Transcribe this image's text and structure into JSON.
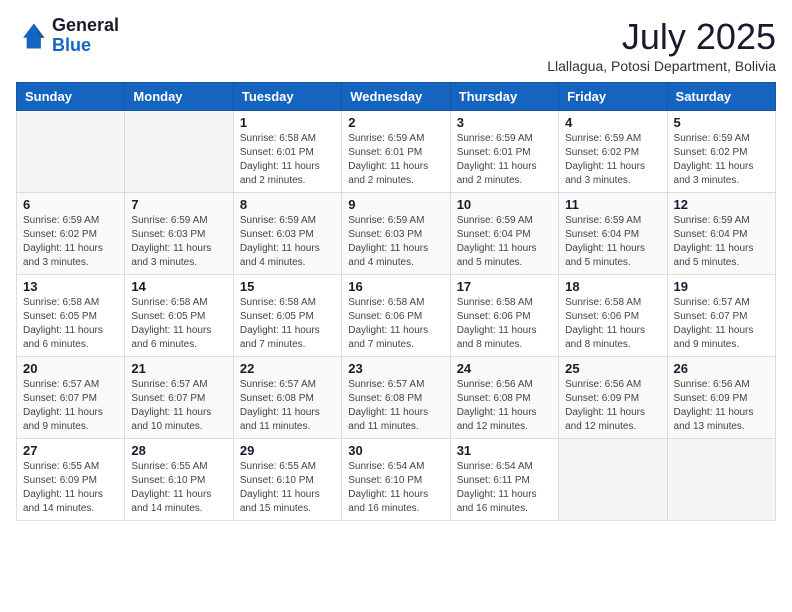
{
  "logo": {
    "general": "General",
    "blue": "Blue"
  },
  "header": {
    "month": "July 2025",
    "subtitle": "Llallagua, Potosi Department, Bolivia"
  },
  "weekdays": [
    "Sunday",
    "Monday",
    "Tuesday",
    "Wednesday",
    "Thursday",
    "Friday",
    "Saturday"
  ],
  "weeks": [
    [
      {
        "day": "",
        "info": ""
      },
      {
        "day": "",
        "info": ""
      },
      {
        "day": "1",
        "info": "Sunrise: 6:58 AM\nSunset: 6:01 PM\nDaylight: 11 hours and 2 minutes."
      },
      {
        "day": "2",
        "info": "Sunrise: 6:59 AM\nSunset: 6:01 PM\nDaylight: 11 hours and 2 minutes."
      },
      {
        "day": "3",
        "info": "Sunrise: 6:59 AM\nSunset: 6:01 PM\nDaylight: 11 hours and 2 minutes."
      },
      {
        "day": "4",
        "info": "Sunrise: 6:59 AM\nSunset: 6:02 PM\nDaylight: 11 hours and 3 minutes."
      },
      {
        "day": "5",
        "info": "Sunrise: 6:59 AM\nSunset: 6:02 PM\nDaylight: 11 hours and 3 minutes."
      }
    ],
    [
      {
        "day": "6",
        "info": "Sunrise: 6:59 AM\nSunset: 6:02 PM\nDaylight: 11 hours and 3 minutes."
      },
      {
        "day": "7",
        "info": "Sunrise: 6:59 AM\nSunset: 6:03 PM\nDaylight: 11 hours and 3 minutes."
      },
      {
        "day": "8",
        "info": "Sunrise: 6:59 AM\nSunset: 6:03 PM\nDaylight: 11 hours and 4 minutes."
      },
      {
        "day": "9",
        "info": "Sunrise: 6:59 AM\nSunset: 6:03 PM\nDaylight: 11 hours and 4 minutes."
      },
      {
        "day": "10",
        "info": "Sunrise: 6:59 AM\nSunset: 6:04 PM\nDaylight: 11 hours and 5 minutes."
      },
      {
        "day": "11",
        "info": "Sunrise: 6:59 AM\nSunset: 6:04 PM\nDaylight: 11 hours and 5 minutes."
      },
      {
        "day": "12",
        "info": "Sunrise: 6:59 AM\nSunset: 6:04 PM\nDaylight: 11 hours and 5 minutes."
      }
    ],
    [
      {
        "day": "13",
        "info": "Sunrise: 6:58 AM\nSunset: 6:05 PM\nDaylight: 11 hours and 6 minutes."
      },
      {
        "day": "14",
        "info": "Sunrise: 6:58 AM\nSunset: 6:05 PM\nDaylight: 11 hours and 6 minutes."
      },
      {
        "day": "15",
        "info": "Sunrise: 6:58 AM\nSunset: 6:05 PM\nDaylight: 11 hours and 7 minutes."
      },
      {
        "day": "16",
        "info": "Sunrise: 6:58 AM\nSunset: 6:06 PM\nDaylight: 11 hours and 7 minutes."
      },
      {
        "day": "17",
        "info": "Sunrise: 6:58 AM\nSunset: 6:06 PM\nDaylight: 11 hours and 8 minutes."
      },
      {
        "day": "18",
        "info": "Sunrise: 6:58 AM\nSunset: 6:06 PM\nDaylight: 11 hours and 8 minutes."
      },
      {
        "day": "19",
        "info": "Sunrise: 6:57 AM\nSunset: 6:07 PM\nDaylight: 11 hours and 9 minutes."
      }
    ],
    [
      {
        "day": "20",
        "info": "Sunrise: 6:57 AM\nSunset: 6:07 PM\nDaylight: 11 hours and 9 minutes."
      },
      {
        "day": "21",
        "info": "Sunrise: 6:57 AM\nSunset: 6:07 PM\nDaylight: 11 hours and 10 minutes."
      },
      {
        "day": "22",
        "info": "Sunrise: 6:57 AM\nSunset: 6:08 PM\nDaylight: 11 hours and 11 minutes."
      },
      {
        "day": "23",
        "info": "Sunrise: 6:57 AM\nSunset: 6:08 PM\nDaylight: 11 hours and 11 minutes."
      },
      {
        "day": "24",
        "info": "Sunrise: 6:56 AM\nSunset: 6:08 PM\nDaylight: 11 hours and 12 minutes."
      },
      {
        "day": "25",
        "info": "Sunrise: 6:56 AM\nSunset: 6:09 PM\nDaylight: 11 hours and 12 minutes."
      },
      {
        "day": "26",
        "info": "Sunrise: 6:56 AM\nSunset: 6:09 PM\nDaylight: 11 hours and 13 minutes."
      }
    ],
    [
      {
        "day": "27",
        "info": "Sunrise: 6:55 AM\nSunset: 6:09 PM\nDaylight: 11 hours and 14 minutes."
      },
      {
        "day": "28",
        "info": "Sunrise: 6:55 AM\nSunset: 6:10 PM\nDaylight: 11 hours and 14 minutes."
      },
      {
        "day": "29",
        "info": "Sunrise: 6:55 AM\nSunset: 6:10 PM\nDaylight: 11 hours and 15 minutes."
      },
      {
        "day": "30",
        "info": "Sunrise: 6:54 AM\nSunset: 6:10 PM\nDaylight: 11 hours and 16 minutes."
      },
      {
        "day": "31",
        "info": "Sunrise: 6:54 AM\nSunset: 6:11 PM\nDaylight: 11 hours and 16 minutes."
      },
      {
        "day": "",
        "info": ""
      },
      {
        "day": "",
        "info": ""
      }
    ]
  ]
}
